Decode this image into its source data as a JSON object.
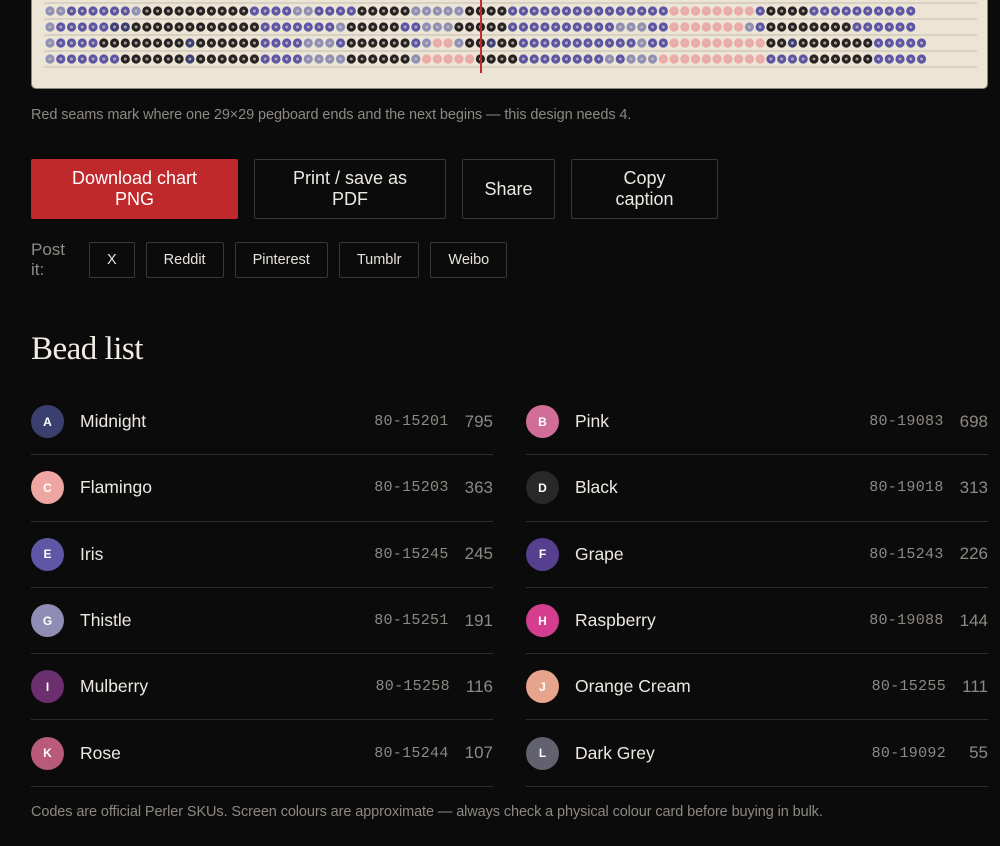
{
  "chart": {
    "palette": {
      "A": "#3b3f73",
      "B": "#d4739a",
      "C": "#eea8a6",
      "D": "#262222",
      "E": "#5c55a6",
      "F": "#4f3f8a",
      "G": "#8f8fb6",
      "K": "#c47087",
      "seam": "#c0292c"
    },
    "rows": [
      "GGEEEEEEGDDDDDDDDDDEEEEGGEEEEDDDDDGGGGGDDDDEEEEEEEEEEEEEEECCCCCCCCEDDDDEEEEEEEEEE",
      "GEEEEEAADDDDDDDDDDDDEEEEEEEGDDDDDEEGGGDDDDDEEEEEEEEEEGGGEECCCCCCCGEDDDDDDDDEEEEEE",
      "GEEEEDDDDDDDDADDDDDDEEEEGGGEDDDDDDEGCCGDDADDEEEEEEEEEEEGEECCCCCCCCCDDADDDDDDDEEEEE",
      "GEEEEEEDDDDDDADDDDDDEEEEGGGGDDDDDDGCCCCCDDDDEEEEEEEEGEGGGCCCCCCCCCCEEEEDDDDDDEEEEE"
    ],
    "seam_columns": [
      40
    ]
  },
  "seam_caption": "Red seams mark where one 29×29 pegboard ends and the next begins — this design needs 4.",
  "actions": {
    "download": "Download chart PNG",
    "print": "Print / save as PDF",
    "share": "Share",
    "copy": "Copy caption"
  },
  "post": {
    "label": "Post it:",
    "targets": [
      "X",
      "Reddit",
      "Pinterest",
      "Tumblr",
      "Weibo"
    ]
  },
  "bead_list": {
    "title": "Bead list",
    "items": [
      {
        "letter": "A",
        "name": "Midnight",
        "code": "80-15201",
        "count": "795",
        "color": "#3b3f6e"
      },
      {
        "letter": "B",
        "name": "Pink",
        "code": "80-19083",
        "count": "698",
        "color": "#d06e97"
      },
      {
        "letter": "C",
        "name": "Flamingo",
        "code": "80-15203",
        "count": "363",
        "color": "#eea6a2"
      },
      {
        "letter": "D",
        "name": "Black",
        "code": "80-19018",
        "count": "313",
        "color": "#2a2727"
      },
      {
        "letter": "E",
        "name": "Iris",
        "code": "80-15245",
        "count": "245",
        "color": "#5e57a6"
      },
      {
        "letter": "F",
        "name": "Grape",
        "code": "80-15243",
        "count": "226",
        "color": "#553f8e"
      },
      {
        "letter": "G",
        "name": "Thistle",
        "code": "80-15251",
        "count": "191",
        "color": "#8f8db3"
      },
      {
        "letter": "H",
        "name": "Raspberry",
        "code": "80-19088",
        "count": "144",
        "color": "#d53d8f"
      },
      {
        "letter": "I",
        "name": "Mulberry",
        "code": "80-15258",
        "count": "116",
        "color": "#6b2f6f"
      },
      {
        "letter": "J",
        "name": "Orange Cream",
        "code": "80-15255",
        "count": "111",
        "color": "#e7a48d"
      },
      {
        "letter": "K",
        "name": "Rose",
        "code": "80-15244",
        "count": "107",
        "color": "#b85a78"
      },
      {
        "letter": "L",
        "name": "Dark Grey",
        "code": "80-19092",
        "count": "55",
        "color": "#626170"
      }
    ],
    "footnote": "Codes are official Perler SKUs. Screen colours are approximate — always check a physical colour card before buying in bulk."
  }
}
